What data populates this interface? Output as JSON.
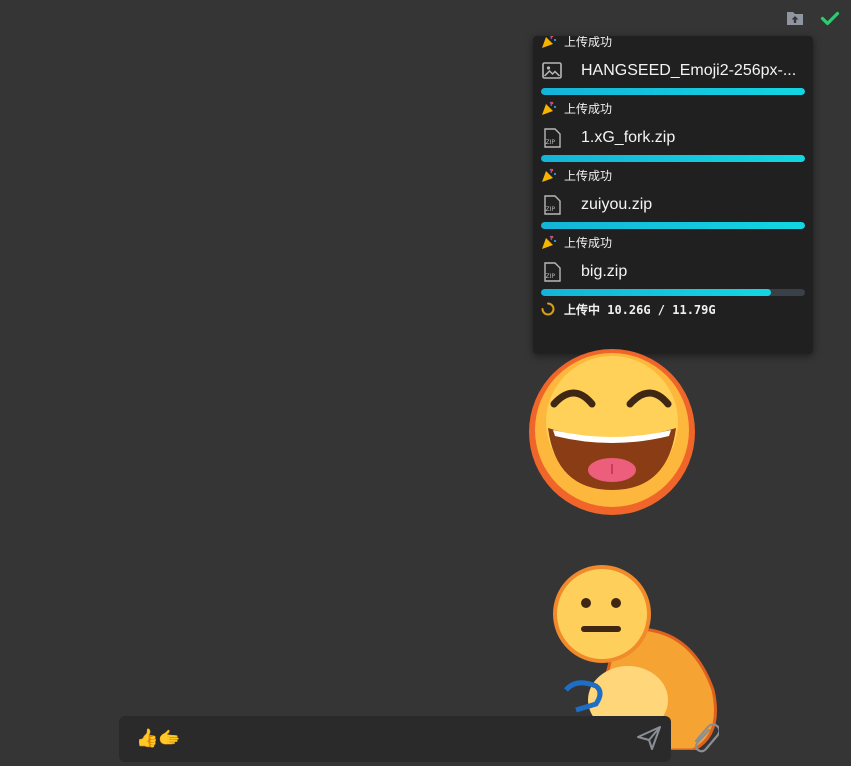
{
  "toolbar": {
    "upload_icon": "folder-upload-icon",
    "done_icon": "check-icon",
    "done_color": "#2ecc71"
  },
  "uploads": {
    "top_status": "上传成功",
    "items": [
      {
        "name": "HANGSEED_Emoji2-256px-...",
        "icon": "image-file-icon",
        "progress": 1.0,
        "status": "上传成功"
      },
      {
        "name": "1.xG_fork.zip",
        "icon": "zip-file-icon",
        "progress": 1.0,
        "status": "上传成功"
      },
      {
        "name": "zuiyou.zip",
        "icon": "zip-file-icon",
        "progress": 1.0,
        "status": "上传成功"
      },
      {
        "name": "big.zip",
        "icon": "zip-file-icon",
        "progress": 0.87,
        "status": "上传中 10.26G / 11.79G"
      }
    ],
    "accent": "#13d6e2"
  },
  "composer": {
    "text": "👍🫱",
    "send_icon": "send-icon",
    "attach_icon": "paperclip-icon"
  }
}
